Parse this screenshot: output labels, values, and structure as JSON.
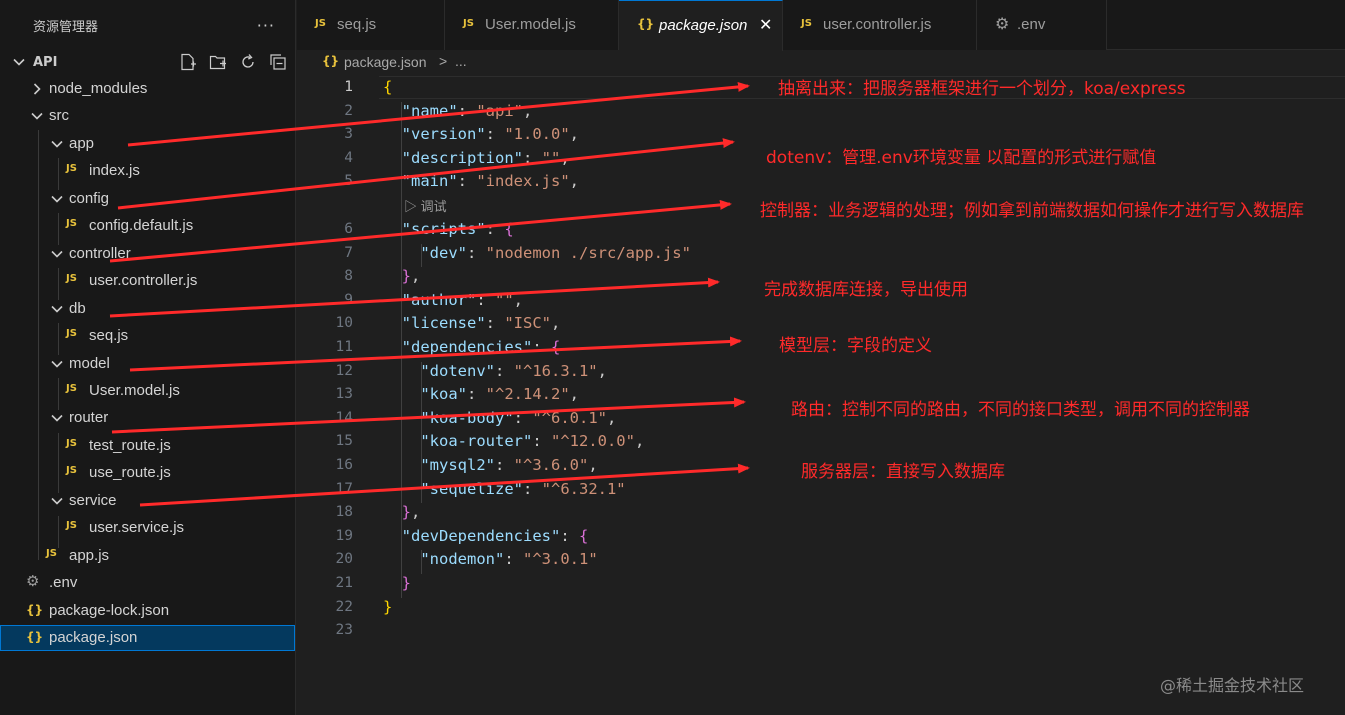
{
  "explorer": {
    "title": "资源管理器",
    "more_label": "···",
    "root_label": "API",
    "actions": [
      "new-file-icon",
      "new-folder-icon",
      "refresh-icon",
      "collapse-all-icon"
    ],
    "items": [
      {
        "label": "node_modules",
        "type": "folder",
        "expanded": false
      },
      {
        "label": "src",
        "type": "folder",
        "expanded": true
      },
      {
        "label": "app",
        "type": "folder",
        "expanded": true
      },
      {
        "label": "index.js",
        "type": "js",
        "icon": "JS"
      },
      {
        "label": "config",
        "type": "folder",
        "expanded": true
      },
      {
        "label": "config.default.js",
        "type": "js",
        "icon": "JS"
      },
      {
        "label": "controller",
        "type": "folder",
        "expanded": true
      },
      {
        "label": "user.controller.js",
        "type": "js",
        "icon": "JS"
      },
      {
        "label": "db",
        "type": "folder",
        "expanded": true
      },
      {
        "label": "seq.js",
        "type": "js",
        "icon": "JS"
      },
      {
        "label": "model",
        "type": "folder",
        "expanded": true
      },
      {
        "label": "User.model.js",
        "type": "js",
        "icon": "JS"
      },
      {
        "label": "router",
        "type": "folder",
        "expanded": true
      },
      {
        "label": "test_route.js",
        "type": "js",
        "icon": "JS"
      },
      {
        "label": "use_route.js",
        "type": "js",
        "icon": "JS"
      },
      {
        "label": "service",
        "type": "folder",
        "expanded": true
      },
      {
        "label": "user.service.js",
        "type": "js",
        "icon": "JS"
      },
      {
        "label": "app.js",
        "type": "js",
        "icon": "JS"
      },
      {
        "label": ".env",
        "type": "env",
        "icon": "⚙"
      },
      {
        "label": "package-lock.json",
        "type": "json",
        "icon": "{}"
      },
      {
        "label": "package.json",
        "type": "json",
        "icon": "{}",
        "selected": true
      }
    ]
  },
  "tabs": [
    {
      "label": "seq.js",
      "icon": "JS"
    },
    {
      "label": "User.model.js",
      "icon": "JS"
    },
    {
      "label": "package.json",
      "icon": "{}",
      "active": true,
      "close": "✕"
    },
    {
      "label": "user.controller.js",
      "icon": "JS"
    },
    {
      "label": ".env",
      "icon": "⚙"
    }
  ],
  "breadcrumb": {
    "icon": "{}",
    "file": "package.json",
    "separator": ">",
    "ellipsis": "..."
  },
  "editor": {
    "codelens": "调试",
    "line_numbers": [
      "1",
      "2",
      "3",
      "4",
      "5",
      "6",
      "7",
      "8",
      "9",
      "10",
      "11",
      "12",
      "13",
      "14",
      "15",
      "16",
      "17",
      "18",
      "19",
      "20",
      "21",
      "22",
      "23"
    ],
    "lines": [
      "{",
      "  \"name\": \"api\",",
      "  \"version\": \"1.0.0\",",
      "  \"description\": \"\",",
      "  \"main\": \"index.js\",",
      "  \"scripts\": {",
      "    \"dev\": \"nodemon ./src/app.js\"",
      "  },",
      "  \"author\": \"\",",
      "  \"license\": \"ISC\",",
      "  \"dependencies\": {",
      "    \"dotenv\": \"^16.3.1\",",
      "    \"koa\": \"^2.14.2\",",
      "    \"koa-body\": \"^6.0.1\",",
      "    \"koa-router\": \"^12.0.0\",",
      "    \"mysql2\": \"^3.6.0\",",
      "    \"sequelize\": \"^6.32.1\"",
      "  },",
      "  \"devDependencies\": {",
      "    \"nodemon\": \"^3.0.1\"",
      "  }",
      "}",
      ""
    ]
  },
  "annotations": [
    "抽离出来：把服务器框架进行一个划分，koa/express",
    "dotenv：管理.env环境变量 以配置的形式进行赋值",
    "控制器：业务逻辑的处理；例如拿到前端数据如何操作才进行写入数据库",
    "完成数据库连接，导出使用",
    "模型层：字段的定义",
    "路由：控制不同的路由，不同的接口类型，调用不同的控制器",
    "服务器层：直接写入数据库"
  ],
  "annotation_color": "#ff2a2a",
  "watermark": "@稀土掘金技术社区"
}
